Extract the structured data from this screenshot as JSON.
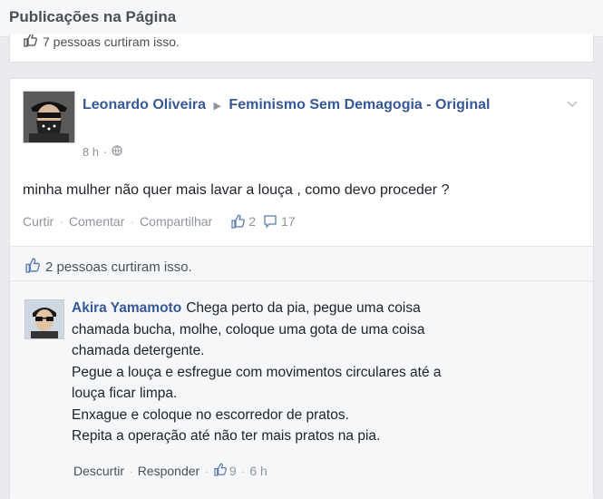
{
  "header": {
    "title": "Publicações na Página"
  },
  "previous_post": {
    "likes_text": "7 pessoas curtiram isso."
  },
  "post": {
    "author": "Leonardo Oliveira",
    "page": "Feminismo Sem Demagogia - Original",
    "time": "8 h",
    "text": "minha mulher não quer mais lavar a louça , como devo proceder ?",
    "actions": {
      "like": "Curtir",
      "comment": "Comentar",
      "share": "Compartilhar"
    },
    "like_count": "2",
    "comment_count": "17",
    "likes_summary": "2 pessoas curtiram isso."
  },
  "comment": {
    "author": "Akira Yamamoto",
    "lines": [
      "Chega perto da pia, pegue uma coisa",
      "chamada bucha, molhe, coloque uma gota de uma coisa",
      "chamada detergente.",
      "Pegue a louça e esfregue com movimentos circulares até a",
      "louça ficar limpa.",
      "Enxague e coloque no escorredor de pratos.",
      "Repita a operação até não ter mais pratos na pia."
    ],
    "actions": {
      "unlike": "Descurtir",
      "reply": "Responder"
    },
    "like_count": "9",
    "time": "6 h"
  },
  "colors": {
    "link": "#365899",
    "muted": "#90949c",
    "background": "#e9ebee"
  },
  "icons": [
    "thumbs-up-icon",
    "comment-icon",
    "globe-icon",
    "chevron-down-icon",
    "triangle-arrow-icon"
  ]
}
